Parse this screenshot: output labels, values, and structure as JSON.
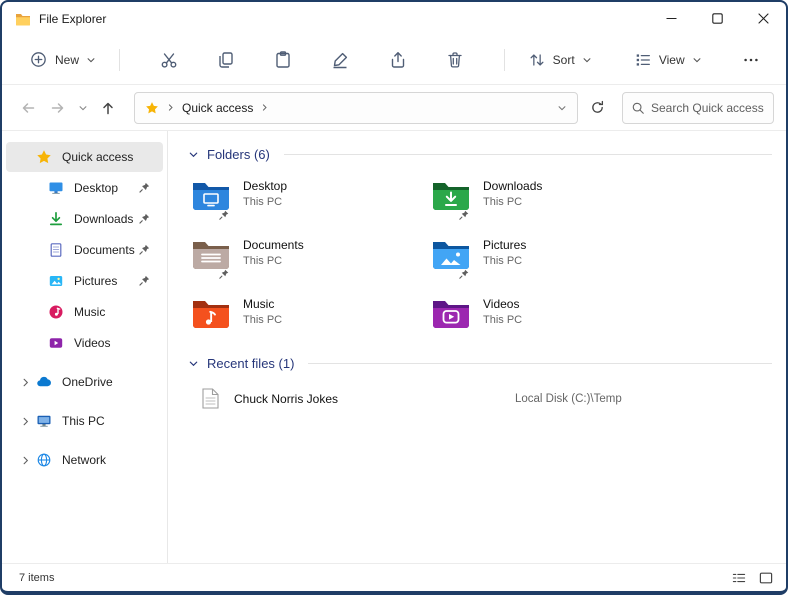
{
  "titlebar": {
    "title": "File Explorer"
  },
  "toolbar": {
    "new_label": "New",
    "sort_label": "Sort",
    "view_label": "View"
  },
  "navbar": {
    "breadcrumb_root": "Quick access",
    "search_placeholder": "Search Quick access"
  },
  "sidebar": {
    "items": [
      {
        "label": "Quick access",
        "selected": true,
        "pinned": false
      },
      {
        "label": "Desktop",
        "selected": false,
        "pinned": true
      },
      {
        "label": "Downloads",
        "selected": false,
        "pinned": true
      },
      {
        "label": "Documents",
        "selected": false,
        "pinned": true
      },
      {
        "label": "Pictures",
        "selected": false,
        "pinned": true
      },
      {
        "label": "Music",
        "selected": false,
        "pinned": false
      },
      {
        "label": "Videos",
        "selected": false,
        "pinned": false
      },
      {
        "label": "OneDrive",
        "selected": false,
        "pinned": false
      },
      {
        "label": "This PC",
        "selected": false,
        "pinned": false
      },
      {
        "label": "Network",
        "selected": false,
        "pinned": false
      }
    ]
  },
  "content": {
    "folders_header": "Folders (6)",
    "folders": [
      {
        "name": "Desktop",
        "location": "This PC"
      },
      {
        "name": "Downloads",
        "location": "This PC"
      },
      {
        "name": "Documents",
        "location": "This PC"
      },
      {
        "name": "Pictures",
        "location": "This PC"
      },
      {
        "name": "Music",
        "location": "This PC"
      },
      {
        "name": "Videos",
        "location": "This PC"
      }
    ],
    "recent_header": "Recent files (1)",
    "recent": [
      {
        "name": "Chuck Norris Jokes",
        "location": "Local Disk (C:)\\Temp"
      }
    ]
  },
  "statusbar": {
    "items_count": "7 items"
  },
  "colors": {
    "window_border": "#1f3d66",
    "accent_star": "#f7b406",
    "selection_bg": "#e9e9e9",
    "group_header_text": "#26367a"
  }
}
